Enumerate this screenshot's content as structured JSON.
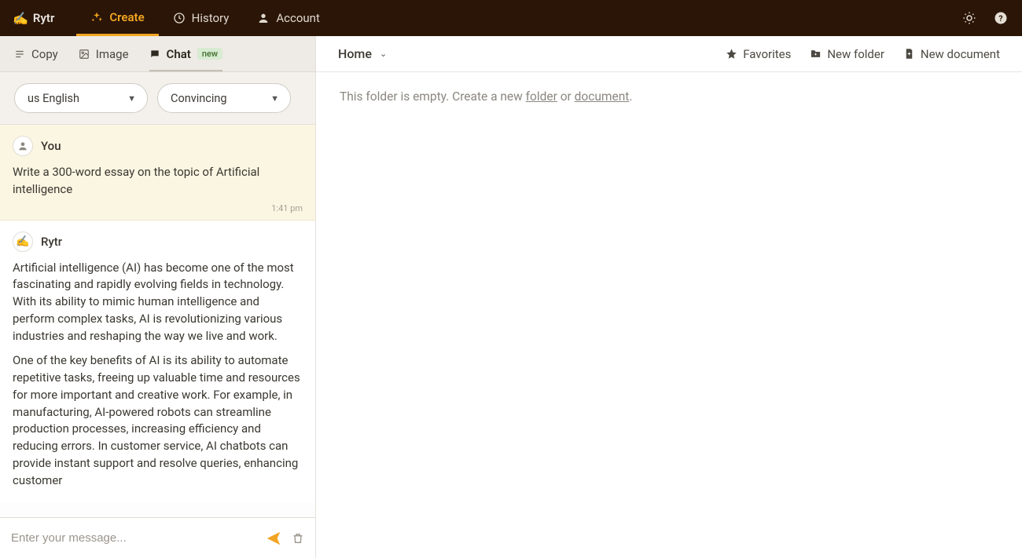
{
  "brand": {
    "name": "Rytr",
    "logo": "✍️"
  },
  "nav": {
    "items": [
      {
        "label": "Create",
        "icon": "sparkle",
        "active": true
      },
      {
        "label": "History",
        "icon": "history",
        "active": false
      },
      {
        "label": "Account",
        "icon": "user",
        "active": false
      }
    ]
  },
  "subtabs": {
    "copy": "Copy",
    "image": "Image",
    "chat": "Chat",
    "badge": "new"
  },
  "selectors": {
    "language": "us English",
    "tone": "Convincing"
  },
  "chat": {
    "user": {
      "name": "You",
      "text": "Write a 300-word essay on the topic of Artificial intelligence",
      "time": "1:41 pm"
    },
    "bot": {
      "name": "Rytr",
      "paragraphs": [
        "Artificial intelligence (AI) has become one of the most fascinating and rapidly evolving fields in technology. With its ability to mimic human intelligence and perform complex tasks, AI is revolutionizing various industries and reshaping the way we live and work.",
        "One of the key benefits of AI is its ability to automate repetitive tasks, freeing up valuable time and resources for more important and creative work. For example, in manufacturing, AI-powered robots can streamline production processes, increasing efficiency and reducing errors. In customer service, AI chatbots can provide instant support and resolve queries, enhancing customer"
      ]
    },
    "input_placeholder": "Enter your message..."
  },
  "docs": {
    "breadcrumb": "Home",
    "actions": {
      "favorites": "Favorites",
      "newfolder": "New folder",
      "newdoc": "New document"
    },
    "empty_prefix": "This folder is empty. Create a new ",
    "empty_folder_link": "folder",
    "empty_or": " or ",
    "empty_document_link": "document",
    "empty_suffix": "."
  }
}
